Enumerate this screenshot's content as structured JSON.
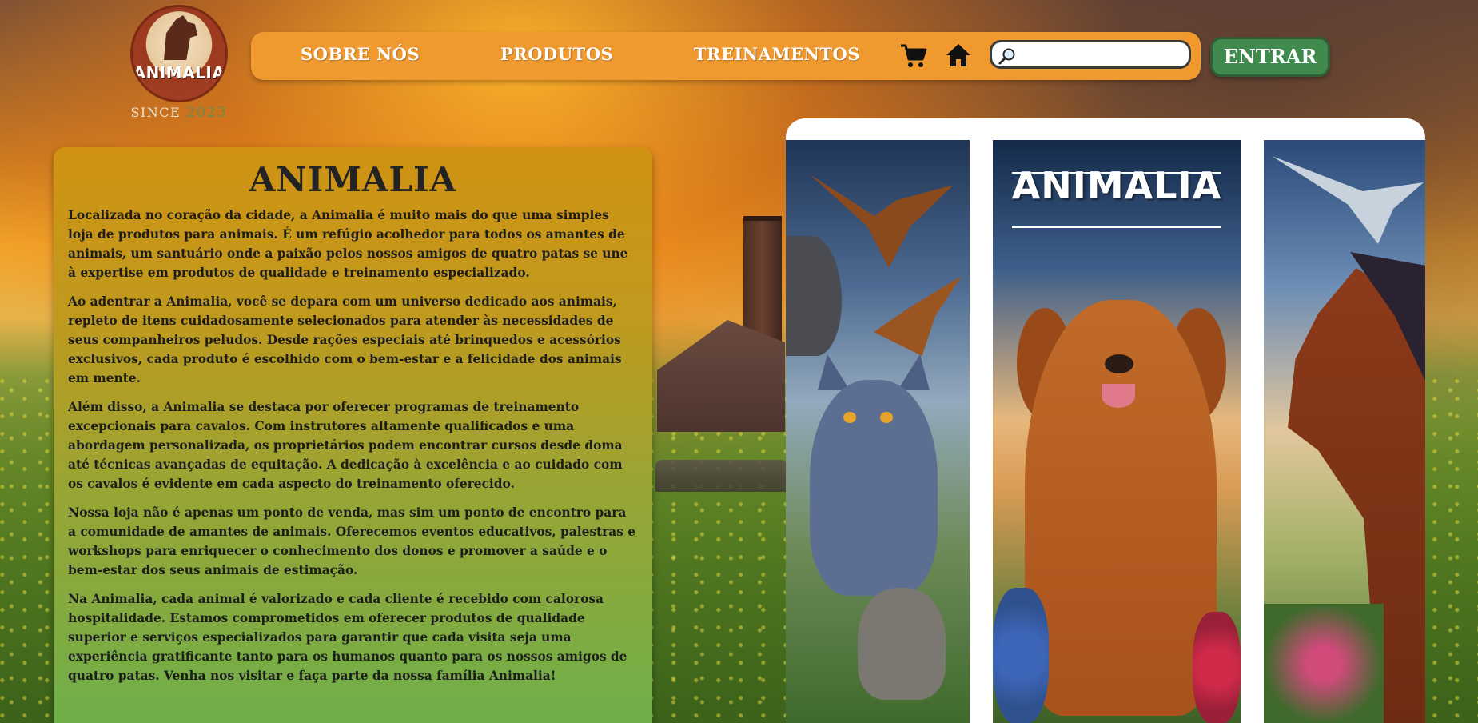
{
  "logo": {
    "name": "ANIMALIA",
    "since_label": "SINCE",
    "since_year": "2023"
  },
  "nav": {
    "items": [
      {
        "label": "SOBRE NÓS"
      },
      {
        "label": "PRODUTOS"
      },
      {
        "label": "TREINAMENTOS"
      }
    ],
    "cart_icon": "cart-icon",
    "home_icon": "home-icon",
    "search": {
      "placeholder": "",
      "value": ""
    },
    "login_label": "ENTRAR"
  },
  "content": {
    "title": "ANIMALIA",
    "paragraphs": [
      "Localizada no coração da cidade, a Animalia é muito mais do que uma simples loja de produtos para animais. É um refúgio acolhedor para todos os amantes de animais, um santuário onde a paixão pelos nossos amigos de quatro patas se une à expertise em produtos de qualidade e treinamento especializado.",
      "Ao adentrar a Animalia, você se depara com um universo dedicado aos animais, repleto de itens cuidadosamente selecionados para atender às necessidades de seus companheiros peludos. Desde rações especiais até brinquedos e acessórios exclusivos, cada produto é escolhido com o bem-estar e a felicidade dos animais em mente.",
      "Além disso, a Animalia se destaca por oferecer programas de treinamento excepcionais para cavalos. Com instrutores altamente qualificados e uma abordagem personalizada, os proprietários podem encontrar cursos desde doma até técnicas avançadas de equitação. A dedicação à excelência e ao cuidado com os cavalos é evidente em cada aspecto do treinamento oferecido.",
      "Nossa loja não é apenas um ponto de venda, mas sim um ponto de encontro para a comunidade de amantes de animais. Oferecemos eventos educativos, palestras e workshops para enriquecer o conhecimento dos donos e promover a saúde e o bem-estar dos seus animais de estimação.",
      "Na Animalia, cada animal é valorizado e cada cliente é recebido com calorosa hospitalidade. Estamos comprometidos em oferecer produtos de qualidade superior e serviços especializados para garantir que cada visita seja uma experiência gratificante tanto para os humanos quanto para os nossos amigos de quatro patas. Venha nos visitar e faça parte da nossa família Animalia!"
    ]
  },
  "gallery": {
    "banner_text": "ANIMALIA",
    "images": [
      "cat-and-eagles-image",
      "golden-retriever-image",
      "horse-image"
    ]
  },
  "colors": {
    "navbar": "#f0992f",
    "login_button": "#3f8a4c",
    "panel_top": "#d19212",
    "panel_bottom": "#6faf4a"
  }
}
